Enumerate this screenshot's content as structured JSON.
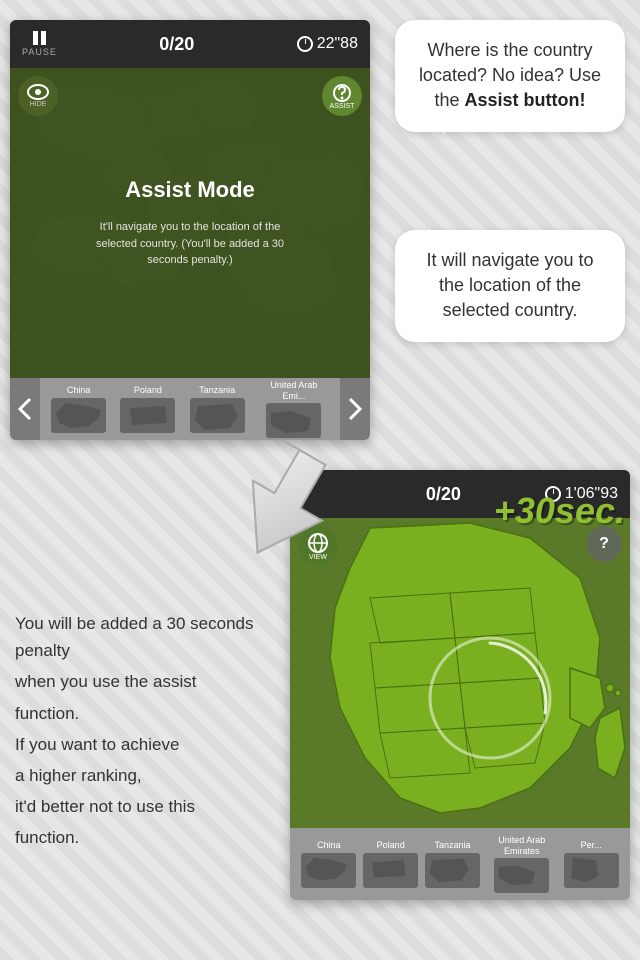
{
  "background": {
    "color": "#ddd"
  },
  "top_screenshot": {
    "top_bar": {
      "pause_label": "PAUSE",
      "score": "0/20",
      "timer": "22\"88"
    },
    "hide_label": "HIDE",
    "assist_label": "ASSIST",
    "assist_mode": {
      "title": "Assist Mode",
      "description": "It'll navigate you to the location of the selected country. (You'll be added a 30 seconds penalty.)"
    },
    "bottom_countries": [
      {
        "name": "China",
        "label": "China"
      },
      {
        "name": "Poland",
        "label": "Poland"
      },
      {
        "name": "Tanzania",
        "label": "Tanzania"
      },
      {
        "name": "United Arab Emirates",
        "label": "United Arab\nEmirates"
      }
    ]
  },
  "bubble1": {
    "line1": "Where is",
    "line2": "the country",
    "line3": "located? No idea?",
    "line4": "Use the",
    "bold": "Assist button!"
  },
  "bubble2": {
    "line1": "It will navigate you",
    "line2": "to the location",
    "line3": "of the selected",
    "line4": "country."
  },
  "bottom_screenshot": {
    "top_bar": {
      "score": "0/20",
      "timer": "1'06\"93"
    },
    "penalty": "+30sec.",
    "view_label": "VIEW",
    "assist_label": "?",
    "bottom_countries": [
      {
        "name": "China",
        "label": "China"
      },
      {
        "name": "Poland",
        "label": "Poland"
      },
      {
        "name": "Tanzania",
        "label": "Tanzania"
      },
      {
        "name": "United Arab Emirates",
        "label": "United Arab\nEmirates"
      },
      {
        "name": "Peru",
        "label": "Per..."
      }
    ]
  },
  "left_text": {
    "para1": "You will be added a 30 seconds penalty",
    "para2": "when you use the assist",
    "para3": "function.",
    "para4": " If you want to achieve",
    "para5": "a higher ranking,",
    "para6": "it'd better not to use this",
    "para7": "function."
  }
}
